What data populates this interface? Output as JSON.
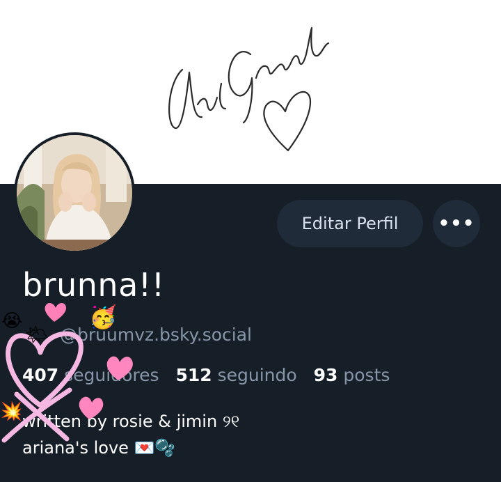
{
  "profile": {
    "display_name": "brunna!!",
    "handle": "@bruumvz.bsky.social",
    "bio_line1": "written by rosie & jimin ୨୧",
    "bio_line2": "ariana's love 💌🫧"
  },
  "stats": {
    "followers_count": "407",
    "followers_label": "seguidores",
    "following_count": "512",
    "following_label": "seguindo",
    "posts_count": "93",
    "posts_label": "posts"
  },
  "actions": {
    "edit_label": "Editar Perfil",
    "more_label": "•••"
  },
  "icons": {
    "more": "ellipsis-icon"
  },
  "colors": {
    "background": "#161e27",
    "button": "#1f2b39",
    "muted_text": "#8796a8",
    "sticker_pink": "#f2b6e0"
  }
}
